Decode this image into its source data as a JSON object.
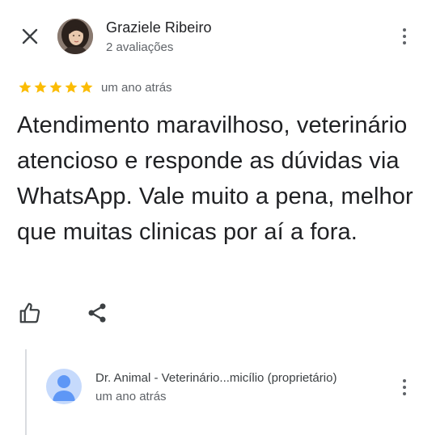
{
  "review": {
    "author_name": "Graziele Ribeiro",
    "author_meta": "2 avaliações",
    "rating": 5,
    "rating_max": 5,
    "time": "um ano atrás",
    "text": "Atendimento maravilhoso, veterinário atencioso e responde as dúvidas via WhatsApp. Vale muito a pena, melhor que muitas clinicas por aí a fora."
  },
  "reply": {
    "owner_name": "Dr. Animal - Veterinário...micílio (proprietário)",
    "time": "um ano atrás"
  },
  "icons": {
    "close": "close-icon",
    "more": "more-vert-icon",
    "like": "thumb-up-icon",
    "share": "share-icon",
    "star": "star-icon"
  },
  "colors": {
    "star": "#fbbc04",
    "text_primary": "#202124",
    "text_secondary": "#5f6368",
    "owner_avatar_bg": "#c6dafc",
    "owner_avatar_fg": "#5e97f6"
  }
}
